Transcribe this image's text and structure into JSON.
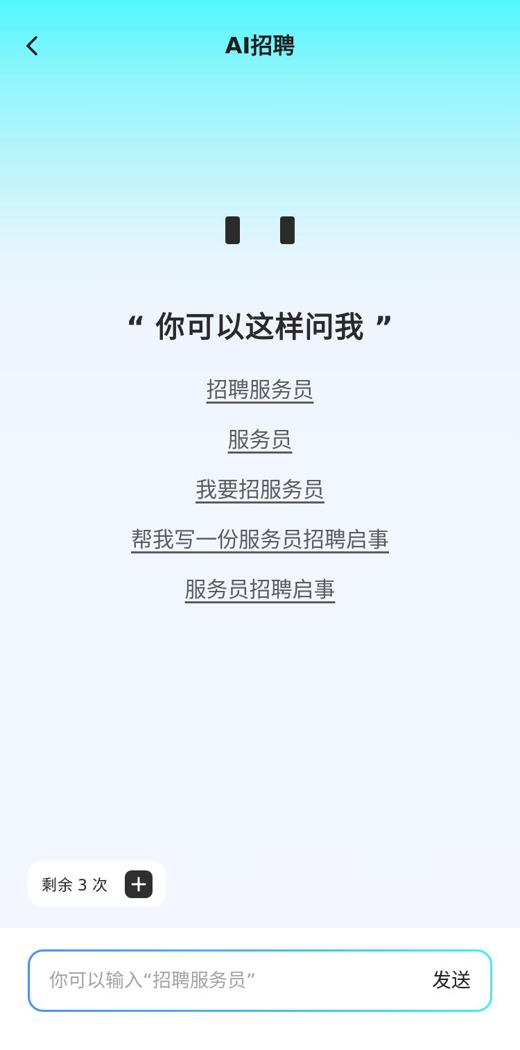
{
  "header": {
    "title": "AI招聘",
    "back_icon": "chevron-left-icon"
  },
  "hero": {
    "open_quote": "“",
    "heading": "你可以这样问我",
    "close_quote": "”",
    "suggestions": [
      {
        "label": "招聘服务员"
      },
      {
        "label": "服务员"
      },
      {
        "label": "我要招服务员"
      },
      {
        "label": "帮我写一份服务员招聘启事"
      },
      {
        "label": "服务员招聘启事"
      }
    ]
  },
  "quota": {
    "prefix": "剩余",
    "count": "3",
    "suffix": "次",
    "add_icon": "plus-icon"
  },
  "composer": {
    "placeholder": "你可以输入“招聘服务员”",
    "value": "",
    "send_label": "发送"
  },
  "colors": {
    "accent_start": "#4f8ef7",
    "accent_end": "#3ef0f4",
    "top_gradient": "#52f7fe",
    "background": "#f3f6fe"
  }
}
